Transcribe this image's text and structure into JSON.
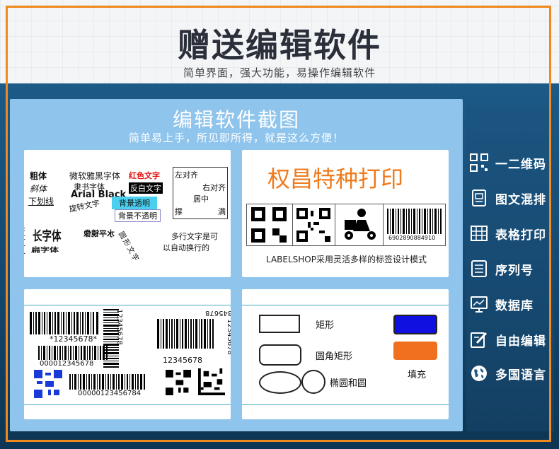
{
  "header": {
    "title": "赠送编辑软件",
    "subtitle": "简单界面，强大功能，易操作编辑软件"
  },
  "panel": {
    "title": "编辑软件截图",
    "subtitle": "简单易上手，所见即所得，就是这么方便！"
  },
  "card1": {
    "bold": "粗体",
    "italic": "斜体",
    "underline": "下划线",
    "weiruan": "微软雅黑字体",
    "lishu": "隶书字体",
    "arial": "Arial Black",
    "rotate": "旋转文字",
    "longbody": "长字体",
    "flatbody": "扁字体",
    "mirror": "水平镜像",
    "red": "红色文字",
    "inverse": "反白文字",
    "bg_transparent": "背景透明",
    "bg_opaque": "背景不透明",
    "align_left": "左对齐",
    "align_right": "右对齐",
    "center": "居中",
    "justify_a": "撑",
    "justify_b": "满",
    "circle_text": "圆形文字",
    "multiline_1": "多行文字是可",
    "multiline_2": "以自动换行的"
  },
  "card2": {
    "brand": "权昌特种打印",
    "barcode_digits": "6902890884910",
    "caption": "LABELSHOP采用灵活多样的标签设计模式",
    "brand_color": "#f07a1c"
  },
  "card3": {
    "code1": "*12345678*",
    "code2": "000012345678",
    "code3": "00000123456784",
    "code4": "12345678",
    "code5": "12345678",
    "code6": "12345678",
    "code7": "12345678",
    "code8": "12345678"
  },
  "card4": {
    "rect": "矩形",
    "rounded": "圆角矩形",
    "ellipse": "椭圆和圆",
    "fill": "填充",
    "blue": "#1010e0",
    "orange": "#f07020"
  },
  "sidebar": {
    "items": [
      {
        "label": "一二维码",
        "icon": "qr-code-icon"
      },
      {
        "label": "图文混排",
        "icon": "document-icon"
      },
      {
        "label": "表格打印",
        "icon": "table-icon"
      },
      {
        "label": "序列号",
        "icon": "list-icon"
      },
      {
        "label": "数据库",
        "icon": "chart-monitor-icon"
      },
      {
        "label": "自由编辑",
        "icon": "edit-icon"
      },
      {
        "label": "多国语言",
        "icon": "globe-icon"
      }
    ]
  }
}
